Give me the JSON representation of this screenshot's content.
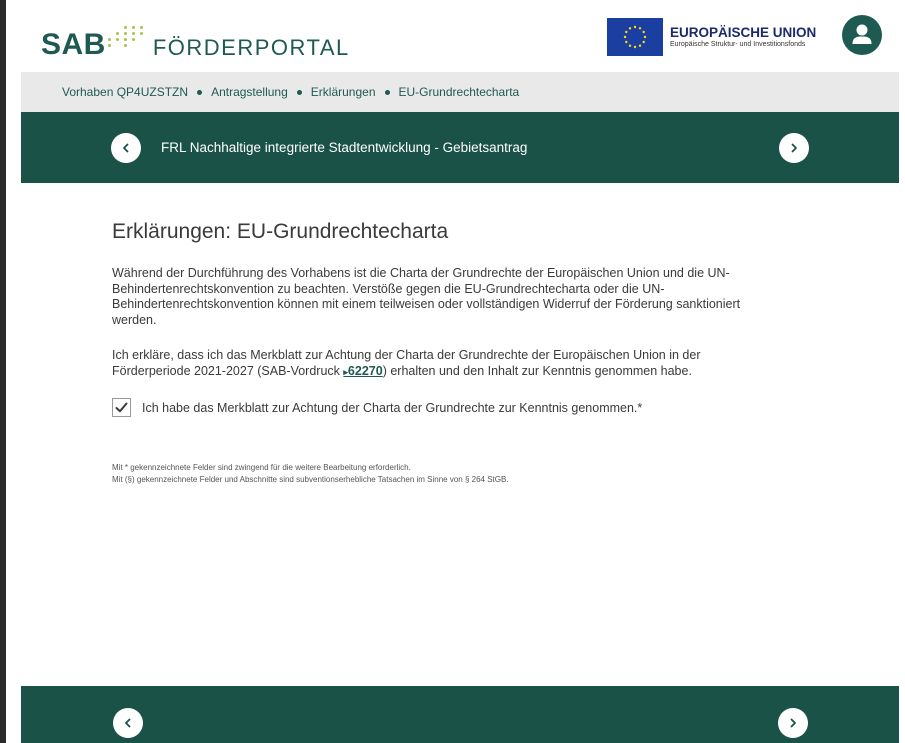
{
  "header": {
    "logo_brand": "SAB",
    "logo_portal": "FÖRDERPORTAL",
    "eu_title": "EUROPÄISCHE UNION",
    "eu_subtitle": "Europäische Struktur- und Investitionsfonds"
  },
  "breadcrumb": {
    "items": [
      "Vorhaben QP4UZSTZN",
      "Antragstellung",
      "Erklärungen",
      "EU-Grundrechtecharta"
    ]
  },
  "program_bar": {
    "title": "FRL Nachhaltige integrierte Stadtentwicklung - Gebietsantrag"
  },
  "main": {
    "heading": "Erklärungen: EU-Grundrechtecharta",
    "paragraph_1_lines": [
      "Während der Durchführung des Vorhabens ist die Charta der Grundrechte der Europäischen Union und die UN-",
      "Behindertenrechtskonvention zu beachten. Verstöße gegen die EU-Grundrechtecharta oder die UN-",
      "Behindertenrechtskonvention können mit einem teilweisen oder vollständigen Widerruf der Förderung sanktioniert",
      "werden."
    ],
    "paragraph_2_line_1": "Ich erkläre, dass ich das Merkblatt zur Achtung der Charta der Grundrechte der Europäischen Union in der",
    "paragraph_2_line_2_before": "Förderperiode 2021-2027 (SAB-Vordruck ",
    "paragraph_2_link": "62270",
    "paragraph_2_line_2_after": ") erhalten und den Inhalt zur Kenntnis genommen habe.",
    "checkbox_label": "Ich habe das Merkblatt zur Achtung der Charta der Grundrechte zur Kenntnis genommen.*",
    "checkbox_checked": true,
    "note_required": "Mit * gekennzeichnete Felder sind zwingend für die weitere Bearbeitung erforderlich.",
    "note_subsidy": "Mit (§) gekennzeichnete Felder und Abschnitte sind subventionserhebliche Tatsachen im Sinne von § 264 StGB."
  },
  "colors": {
    "brand_green": "#1a5248",
    "accent_dots": "#a6c54c",
    "eu_blue": "#1b3fa0",
    "eu_star": "#ffdd00",
    "breadcrumb_bg": "#e9e9e9"
  },
  "icons": {
    "avatar": "user-icon",
    "prev": "chevron-left-icon",
    "next": "chevron-right-icon",
    "checkbox": "checkmark-icon",
    "link_prefix": "arrow-right-icon"
  }
}
